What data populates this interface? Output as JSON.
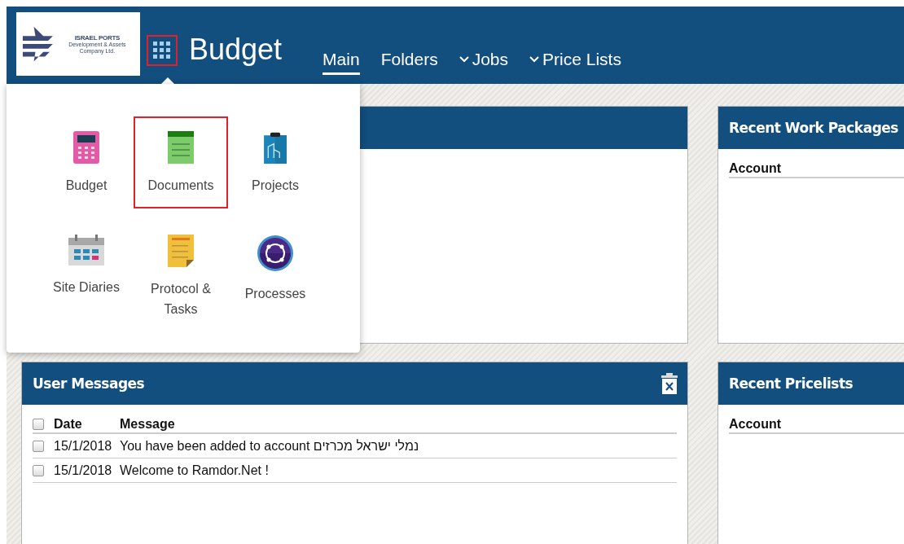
{
  "header": {
    "logo": {
      "title": "ISRAEL PORTS",
      "subtitle": "Development & Assets Company Ltd."
    },
    "launcher": {
      "highlighted": true
    },
    "app_title": "Budget",
    "nav": [
      {
        "label": "Main",
        "selected": true,
        "dropdown": false
      },
      {
        "label": "Folders",
        "selected": false,
        "dropdown": false
      },
      {
        "label": "Jobs",
        "selected": false,
        "dropdown": true
      },
      {
        "label": "Price Lists",
        "selected": false,
        "dropdown": true
      }
    ]
  },
  "app_menu": {
    "items": [
      {
        "kind": "calculator",
        "label": "Budget",
        "highlighted": false
      },
      {
        "kind": "document",
        "label": "Documents",
        "highlighted": true
      },
      {
        "kind": "clipboard",
        "label": "Projects",
        "highlighted": false
      },
      {
        "kind": "calendar",
        "label": "Site Diaries",
        "highlighted": false
      },
      {
        "kind": "note",
        "label": "Protocol & Tasks",
        "highlighted": false
      },
      {
        "kind": "cycle",
        "label": "Processes",
        "highlighted": false
      }
    ]
  },
  "panels": [
    {
      "kind": "blank"
    },
    {
      "kind": "list",
      "title": "Recent Work Packages",
      "columns": [
        "Account"
      ]
    },
    {
      "kind": "messages",
      "title": "User Messages",
      "columns": [
        "Date",
        "Message"
      ],
      "all_checked": false,
      "rows": [
        {
          "checked": false,
          "date": "15/1/2018",
          "message": "You have been added to account נמלי ישראל מכרזים"
        },
        {
          "checked": false,
          "date": "15/1/2018",
          "message": "Welcome to Ramdor.Net !"
        }
      ]
    },
    {
      "kind": "list",
      "title": "Recent Pricelists",
      "columns": [
        "Account"
      ]
    }
  ]
}
